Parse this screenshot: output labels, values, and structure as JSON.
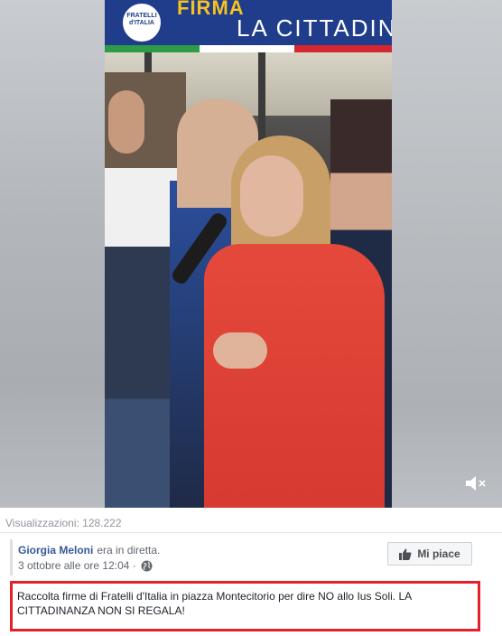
{
  "video": {
    "banner_logo_text": "FRATELLI d'ITALIA",
    "banner_title": "FIRMA",
    "banner_subtitle": "LA CITTADINAN"
  },
  "stats": {
    "views": "Visualizzazioni: 128.222"
  },
  "post": {
    "author": "Giorgia Meloni",
    "action": "era in diretta.",
    "date": "3 ottobre alle ore 12:04 ·",
    "like_label": "Mi piace",
    "caption": "Raccolta firme di Fratelli d'Italia in piazza Montecitorio per dire NO allo Ius Soli. LA CITTADINANZA NON SI REGALA!"
  },
  "colors": {
    "link": "#365899",
    "highlight_border": "#e3202b",
    "banner_blue": "#1f3d8a"
  },
  "icons": [
    "mute-icon",
    "globe-icon",
    "thumbs-up-icon"
  ]
}
